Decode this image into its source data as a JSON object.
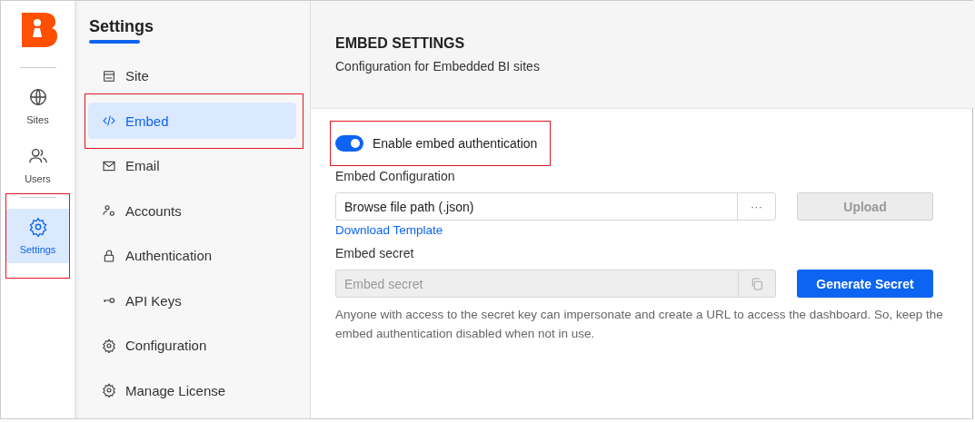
{
  "rail": {
    "items": [
      {
        "kind": "globe",
        "label": "Sites",
        "selected": false,
        "highlighted": false
      },
      {
        "kind": "users",
        "label": "Users",
        "selected": false,
        "highlighted": false
      },
      {
        "kind": "gear",
        "label": "Settings",
        "selected": true,
        "highlighted": true
      }
    ]
  },
  "settings_menu": {
    "title": "Settings",
    "items": [
      {
        "kind": "site",
        "label": "Site",
        "selected": false,
        "highlighted": false
      },
      {
        "kind": "code",
        "label": "Embed",
        "selected": true,
        "highlighted": true
      },
      {
        "kind": "mail",
        "label": "Email",
        "selected": false,
        "highlighted": false
      },
      {
        "kind": "accounts",
        "label": "Accounts",
        "selected": false,
        "highlighted": false
      },
      {
        "kind": "lock",
        "label": "Authentication",
        "selected": false,
        "highlighted": false
      },
      {
        "kind": "key",
        "label": "API Keys",
        "selected": false,
        "highlighted": false
      },
      {
        "kind": "gear",
        "label": "Configuration",
        "selected": false,
        "highlighted": false
      },
      {
        "kind": "gear",
        "label": "Manage License",
        "selected": false,
        "highlighted": false
      }
    ]
  },
  "header": {
    "title": "EMBED SETTINGS",
    "subtitle": "Configuration for Embedded BI sites"
  },
  "toggle": {
    "label": "Enable embed authentication",
    "on": true,
    "highlighted": true
  },
  "embed_configuration": {
    "label": "Embed Configuration",
    "placeholder": "Browse file path (.json)",
    "browse": "···",
    "upload": "Upload",
    "upload_disabled": true,
    "link": "Download Template"
  },
  "embed_secret": {
    "label": "Embed secret",
    "placeholder": "Embed secret",
    "disabled": true,
    "button": "Generate Secret"
  },
  "help": "Anyone with access to the secret key can impersonate and create a URL to access the dashboard. So, keep the embed authentication disabled when not in use."
}
